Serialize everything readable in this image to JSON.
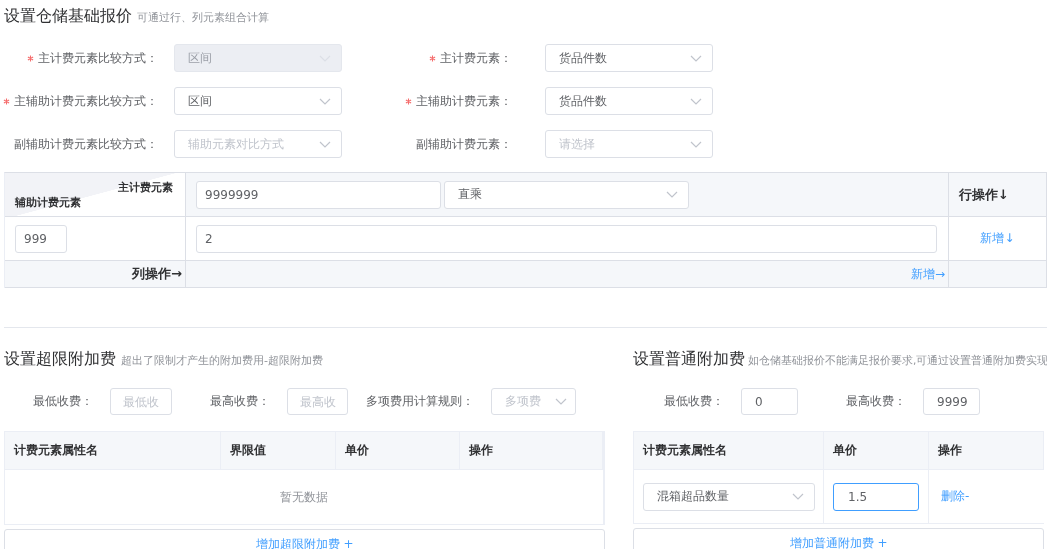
{
  "base_pricing": {
    "title": "设置仓储基础报价",
    "subtitle": "可通过行、列元素组合计算",
    "fields": [
      {
        "label": "主计费元素比较方式：",
        "required": true,
        "value": "区间",
        "disabled": true
      },
      {
        "label": "主计费元素：",
        "required": true,
        "value": "货品件数",
        "disabled": false
      },
      {
        "label": "主辅助计费元素比较方式：",
        "required": true,
        "value": "区间",
        "disabled": false
      },
      {
        "label": "主辅助计费元素：",
        "required": true,
        "value": "货品件数",
        "disabled": false
      },
      {
        "label": "副辅助计费元素比较方式：",
        "required": false,
        "placeholder": "辅助元素对比方式",
        "disabled": false
      },
      {
        "label": "副辅助计费元素：",
        "required": false,
        "placeholder": "请选择",
        "disabled": false
      }
    ],
    "matrix": {
      "corner_top": "主计费元素",
      "corner_bottom": "辅助计费元素",
      "header_value": "9999999",
      "header_operation": "直乘",
      "row_action_header": "行操作↓",
      "rows": [
        {
          "aux_value": "999",
          "value": "2",
          "action": "新增↓"
        }
      ],
      "column_action_label": "列操作→",
      "column_action": "新增→"
    }
  },
  "overlimit_surcharge": {
    "title": "设置超限附加费",
    "subtitle": "超出了限制才产生的附加费用-超限附加费",
    "fields": [
      {
        "kind": "input",
        "label": "最低收费：",
        "placeholder": "最低收"
      },
      {
        "kind": "input",
        "label": "最高收费：",
        "placeholder": "最高收"
      },
      {
        "kind": "select",
        "label": "多项费用计算规则：",
        "placeholder": "多项费"
      }
    ],
    "table": {
      "columns": [
        "计费元素属性名",
        "界限值",
        "单价",
        "操作"
      ],
      "empty_text": "暂无数据"
    },
    "add_button": "增加超限附加费 +"
  },
  "normal_surcharge": {
    "title": "设置普通附加费",
    "subtitle": "如仓储基础报价不能满足报价要求,可通过设置普通附加费实现",
    "fields": [
      {
        "kind": "input",
        "label": "最低收费：",
        "value": "0"
      },
      {
        "kind": "input",
        "label": "最高收费：",
        "value": "9999"
      }
    ],
    "table": {
      "columns": [
        "计费元素属性名",
        "单价",
        "操作"
      ],
      "rows": [
        {
          "attribute": "混箱超品数量",
          "unit_price": "1.5",
          "unit_price_focused": true,
          "action": "删除-"
        }
      ]
    },
    "add_button": "增加普通附加费 +"
  }
}
